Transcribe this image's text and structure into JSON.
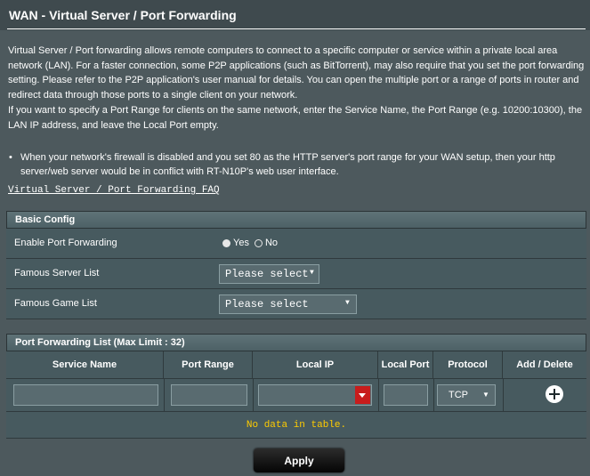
{
  "page": {
    "title": "WAN - Virtual Server / Port Forwarding"
  },
  "description": {
    "paragraph1": "Virtual Server / Port forwarding allows remote computers to connect to a specific computer or service within a private local area network (LAN). For a faster connection, some P2P applications (such as BitTorrent), may also require that you set the port forwarding setting. Please refer to the P2P application's user manual for details. You can open the multiple port or a range of ports in router and redirect data through those ports to a single client on your network.",
    "paragraph2": "If you want to specify a Port Range for clients on the same network, enter the Service Name, the Port Range (e.g. 10200:10300), the LAN IP address, and leave the Local Port empty.",
    "note": "When your network's firewall is disabled and you set 80 as the HTTP server's port range for your WAN setup, then your http server/web server would be in conflict with RT-N10P's web user interface.",
    "faq_link": "Virtual Server / Port Forwarding FAQ"
  },
  "basic_config": {
    "header": "Basic Config",
    "enable_port_forwarding": {
      "label": "Enable Port Forwarding",
      "options": [
        "Yes",
        "No"
      ],
      "selected": "Yes"
    },
    "famous_server_list": {
      "label": "Famous Server List",
      "value": "Please select",
      "arrow": "▼"
    },
    "famous_game_list": {
      "label": "Famous Game List",
      "value": "Please select",
      "arrow": "▼"
    }
  },
  "port_forwarding_list": {
    "header": "Port Forwarding List (Max Limit : 32)",
    "columns": [
      "Service Name",
      "Port Range",
      "Local IP",
      "Local Port",
      "Protocol",
      "Add / Delete"
    ],
    "input_row": {
      "service_name": "",
      "port_range": "",
      "local_ip": "",
      "local_port": "",
      "protocol": "TCP",
      "protocol_arrow": "▼"
    },
    "empty_message": "No data in table."
  },
  "actions": {
    "apply_label": "Apply"
  },
  "colors": {
    "background": "#4d595d",
    "row_background": "#475a5f",
    "combo_button": "#c81c1c",
    "empty_message": "#ffcc00"
  },
  "icons": {
    "add": "plus-circle-icon",
    "dropdown": "chevron-down-icon"
  }
}
